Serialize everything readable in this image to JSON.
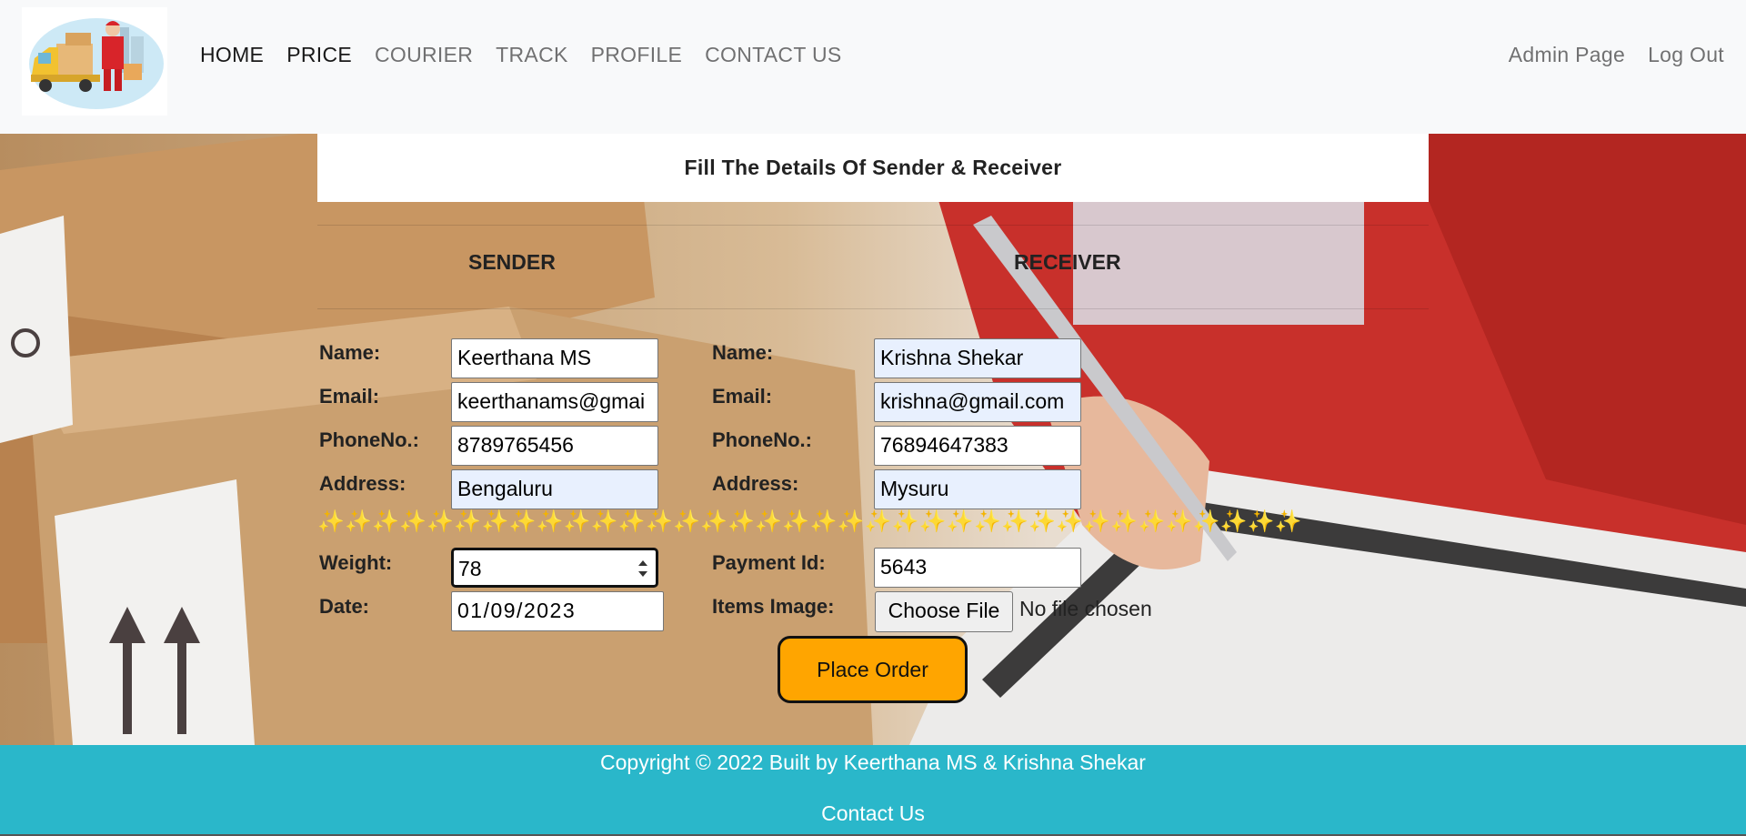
{
  "nav": {
    "links": [
      "HOME",
      "PRICE",
      "COURIER",
      "TRACK",
      "PROFILE",
      "CONTACT US"
    ],
    "right": [
      "Admin Page",
      "Log Out"
    ]
  },
  "form": {
    "title": "Fill The Details Of Sender & Receiver",
    "sender_heading": "SENDER",
    "receiver_heading": "RECEIVER",
    "labels": {
      "name": "Name:",
      "email": "Email:",
      "phone": "PhoneNo.:",
      "address": "Address:",
      "weight": "Weight:",
      "date": "Date:",
      "payment": "Payment Id:",
      "items_image": "Items Image:"
    },
    "sender": {
      "name": "Keerthana MS",
      "email": "keerthanams@gmai",
      "phone": "8789765456",
      "address": "Bengaluru",
      "weight": "78",
      "date": "01/09/2023"
    },
    "receiver": {
      "name": "Krishna Shekar",
      "email": "krishna@gmail.com",
      "phone": "76894647383",
      "address": "Mysuru",
      "payment_id": "5643"
    },
    "sparkles": "✨✨✨✨✨✨✨✨✨✨✨✨✨✨✨✨✨✨✨✨✨✨✨✨✨✨✨✨✨✨✨✨✨✨✨✨",
    "file_button": "Choose File",
    "file_status": "No file chosen",
    "submit": "Place Order"
  },
  "footer": {
    "copyright": "Copyright © 2022 Built by Keerthana MS & Krishna Shekar",
    "contact": "Contact Us"
  },
  "colors": {
    "accent_button": "#FFA500",
    "footer_bg": "#2AB7CA",
    "autofill_bg": "#E8F0FE"
  },
  "icons": [
    "delivery-logo-icon",
    "sparkle-icon",
    "spinner-icon"
  ]
}
